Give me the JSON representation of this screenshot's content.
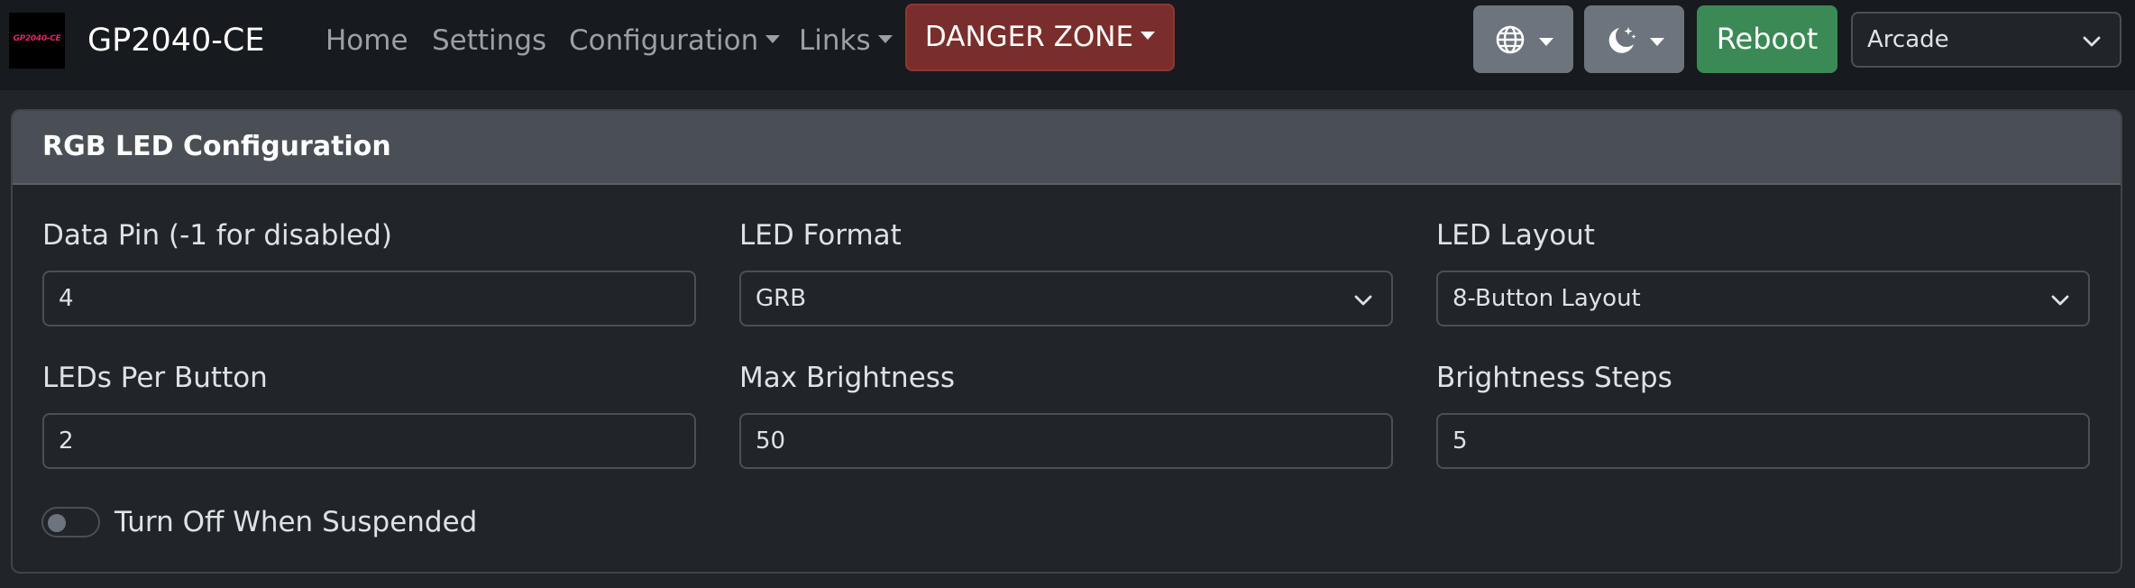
{
  "navbar": {
    "logo_text": "GP2040-CE",
    "brand": "GP2040-CE",
    "links": {
      "home": "Home",
      "settings": "Settings",
      "configuration": "Configuration",
      "links": "Links"
    },
    "danger_zone": "DANGER ZONE",
    "language_icon": "globe-icon",
    "theme_icon": "moon-stars-icon",
    "reboot": "Reboot",
    "input_mode_select": "Arcade",
    "colors": {
      "danger": "#7a2e2b",
      "secondary": "#6c757d",
      "success": "#3b8a56"
    }
  },
  "card": {
    "title": "RGB LED Configuration",
    "fields": {
      "data_pin": {
        "label": "Data Pin (-1 for disabled)",
        "value": "4"
      },
      "led_format": {
        "label": "LED Format",
        "value": "GRB"
      },
      "led_layout": {
        "label": "LED Layout",
        "value": "8-Button Layout"
      },
      "leds_per_button": {
        "label": "LEDs Per Button",
        "value": "2"
      },
      "max_brightness": {
        "label": "Max Brightness",
        "value": "50"
      },
      "brightness_steps": {
        "label": "Brightness Steps",
        "value": "5"
      }
    },
    "turn_off_when_suspended": {
      "label": "Turn Off When Suspended",
      "checked": false
    }
  }
}
